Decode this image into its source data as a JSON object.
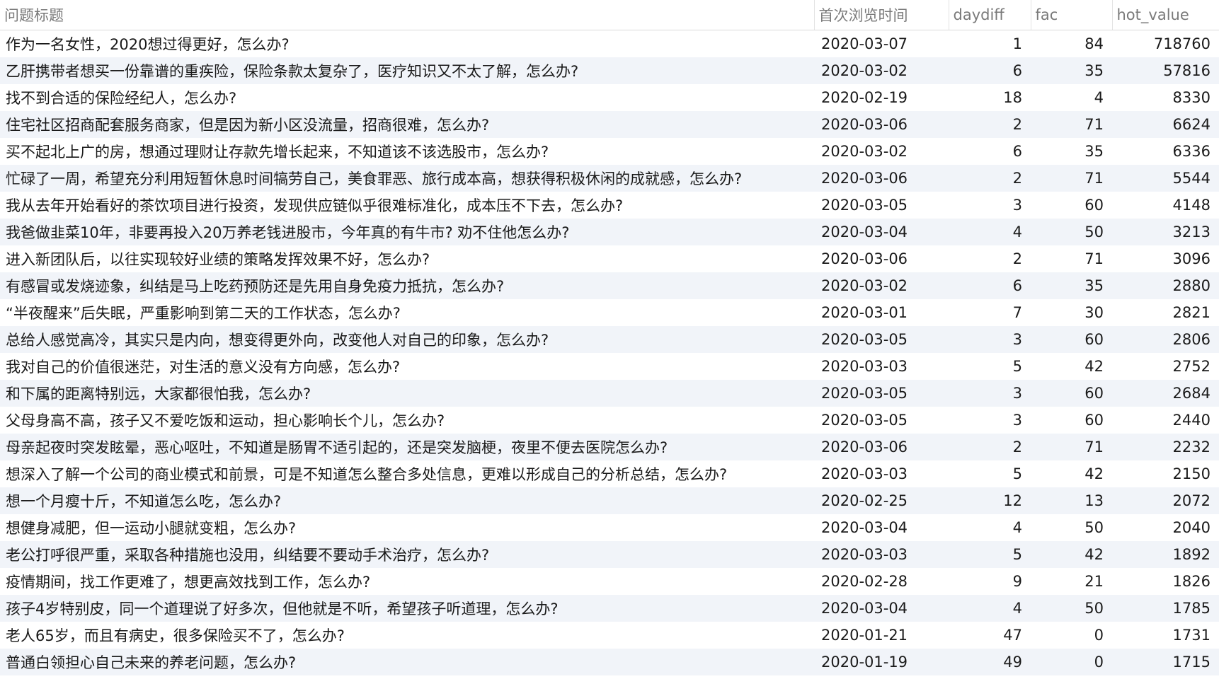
{
  "columns": [
    "问题标题",
    "首次浏览时间",
    "daydiff",
    "fac",
    "hot_value"
  ],
  "rows": [
    {
      "title": "作为一名女性，2020想过得更好，怎么办?",
      "date": "2020-03-07",
      "daydiff": "1",
      "fac": "84",
      "hot_value": "718760"
    },
    {
      "title": "乙肝携带者想买一份靠谱的重疾险，保险条款太复杂了，医疗知识又不太了解，怎么办?",
      "date": "2020-03-02",
      "daydiff": "6",
      "fac": "35",
      "hot_value": "57816"
    },
    {
      "title": "找不到合适的保险经纪人，怎么办?",
      "date": "2020-02-19",
      "daydiff": "18",
      "fac": "4",
      "hot_value": "8330"
    },
    {
      "title": "住宅社区招商配套服务商家，但是因为新小区没流量，招商很难，怎么办?",
      "date": "2020-03-06",
      "daydiff": "2",
      "fac": "71",
      "hot_value": "6624"
    },
    {
      "title": "买不起北上广的房，想通过理财让存款先增长起来，不知道该不该选股市，怎么办?",
      "date": "2020-03-02",
      "daydiff": "6",
      "fac": "35",
      "hot_value": "6336"
    },
    {
      "title": "忙碌了一周，希望充分利用短暂休息时间犒劳自己，美食罪恶、旅行成本高，想获得积极休闲的成就感，怎么办?",
      "date": "2020-03-06",
      "daydiff": "2",
      "fac": "71",
      "hot_value": "5544"
    },
    {
      "title": "我从去年开始看好的茶饮项目进行投资，发现供应链似乎很难标准化，成本压不下去，怎么办?",
      "date": "2020-03-05",
      "daydiff": "3",
      "fac": "60",
      "hot_value": "4148"
    },
    {
      "title": "我爸做韭菜10年，非要再投入20万养老钱进股市，今年真的有牛市? 劝不住他怎么办?",
      "date": "2020-03-04",
      "daydiff": "4",
      "fac": "50",
      "hot_value": "3213"
    },
    {
      "title": "进入新团队后，以往实现较好业绩的策略发挥效果不好，怎么办?",
      "date": "2020-03-06",
      "daydiff": "2",
      "fac": "71",
      "hot_value": "3096"
    },
    {
      "title": "有感冒或发烧迹象，纠结是马上吃药预防还是先用自身免疫力抵抗，怎么办?",
      "date": "2020-03-02",
      "daydiff": "6",
      "fac": "35",
      "hot_value": "2880"
    },
    {
      "title": "“半夜醒来”后失眠，严重影响到第二天的工作状态，怎么办?",
      "date": "2020-03-01",
      "daydiff": "7",
      "fac": "30",
      "hot_value": "2821"
    },
    {
      "title": "总给人感觉高冷，其实只是内向，想变得更外向，改变他人对自己的印象，怎么办?",
      "date": "2020-03-05",
      "daydiff": "3",
      "fac": "60",
      "hot_value": "2806"
    },
    {
      "title": "我对自己的价值很迷茫，对生活的意义没有方向感，怎么办?",
      "date": "2020-03-03",
      "daydiff": "5",
      "fac": "42",
      "hot_value": "2752"
    },
    {
      "title": "和下属的距离特别远，大家都很怕我，怎么办?",
      "date": "2020-03-05",
      "daydiff": "3",
      "fac": "60",
      "hot_value": "2684"
    },
    {
      "title": "父母身高不高，孩子又不爱吃饭和运动，担心影响长个儿，怎么办?",
      "date": "2020-03-05",
      "daydiff": "3",
      "fac": "60",
      "hot_value": "2440"
    },
    {
      "title": "母亲起夜时突发眩晕，恶心呕吐，不知道是肠胃不适引起的，还是突发脑梗，夜里不便去医院怎么办?",
      "date": "2020-03-06",
      "daydiff": "2",
      "fac": "71",
      "hot_value": "2232"
    },
    {
      "title": "想深入了解一个公司的商业模式和前景，可是不知道怎么整合多处信息，更难以形成自己的分析总结，怎么办?",
      "date": "2020-03-03",
      "daydiff": "5",
      "fac": "42",
      "hot_value": "2150"
    },
    {
      "title": "想一个月瘦十斤，不知道怎么吃，怎么办?",
      "date": "2020-02-25",
      "daydiff": "12",
      "fac": "13",
      "hot_value": "2072"
    },
    {
      "title": "想健身减肥，但一运动小腿就变粗，怎么办?",
      "date": "2020-03-04",
      "daydiff": "4",
      "fac": "50",
      "hot_value": "2040"
    },
    {
      "title": "老公打呼很严重，采取各种措施也没用，纠结要不要动手术治疗，怎么办?",
      "date": "2020-03-03",
      "daydiff": "5",
      "fac": "42",
      "hot_value": "1892"
    },
    {
      "title": "疫情期间，找工作更难了，想更高效找到工作，怎么办?",
      "date": "2020-02-28",
      "daydiff": "9",
      "fac": "21",
      "hot_value": "1826"
    },
    {
      "title": "孩子4岁特别皮，同一个道理说了好多次，但他就是不听，希望孩子听道理，怎么办?",
      "date": "2020-03-04",
      "daydiff": "4",
      "fac": "50",
      "hot_value": "1785"
    },
    {
      "title": "老人65岁，而且有病史，很多保险买不了，怎么办?",
      "date": "2020-01-21",
      "daydiff": "47",
      "fac": "0",
      "hot_value": "1731"
    },
    {
      "title": "普通白领担心自己未来的养老问题，怎么办?",
      "date": "2020-01-19",
      "daydiff": "49",
      "fac": "0",
      "hot_value": "1715"
    }
  ]
}
